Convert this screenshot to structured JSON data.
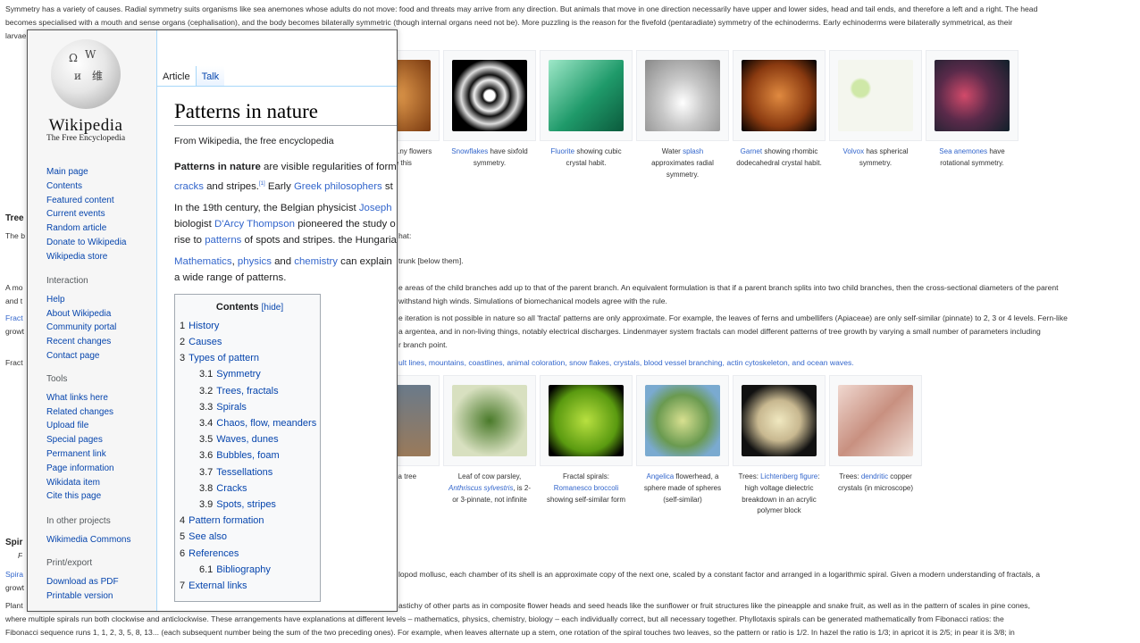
{
  "background": {
    "p1a": "Symmetry has a variety of causes. Radial symmetry suits organisms like sea anemones whose adults do not move: food and threats may arrive from any direction. But animals that move in one direction necessarily have upper and lower sides, head and tail ends, and therefore a left and a right. The head",
    "p1b": "becomes specialised with a mouth and sense organs (cephalisation), and the body becomes bilaterally symmetric (though internal organs need not be). More puzzling is the reason for the fivefold (pentaradiate) symmetry of the echinoderms. Early echinoderms were bilaterally symmetrical, as their",
    "p1c": "larvae still are. ... logical causes.",
    "gallery1": [
      {
        "pre": "",
        "link": "",
        "post": "...metry can ...ny flowers ...ts like this"
      },
      {
        "pre": "",
        "link": "Snowflakes",
        "post": " have sixfold symmetry."
      },
      {
        "pre": "",
        "link": "Fluorite",
        "post": " showing cubic crystal habit."
      },
      {
        "pre": "Water ",
        "link": "splash",
        "post": " approximates radial symmetry."
      },
      {
        "pre": "",
        "link": "Garnet",
        "post": " showing rhombic dodecahedral crystal habit."
      },
      {
        "pre": "",
        "link": "Volvox",
        "post": " has spherical symmetry."
      },
      {
        "pre": "",
        "link": "Sea anemones",
        "post": " have rotational symmetry."
      }
    ],
    "trees_heading": "Tree",
    "trees_sub": "The b",
    "p2a": "hat:",
    "p2b": "trunk [below them].",
    "p3a": "A mo",
    "p3b": "and t",
    "p3c": "e areas of the child branches add up to that of the parent branch. An equivalent formulation is that if a parent branch splits into two child branches, then the cross-sectional diameters of the parent",
    "p3d": "withstand high winds. Simulations of biomechanical models agree with the rule.",
    "p4a": "Fract",
    "p4b": "growt",
    "p4c": "e iteration is not possible in nature so all 'fractal' patterns are only approximate. For example, the leaves of ferns and umbellifers (Apiaceae) are only self-similar (pinnate) to 2, 3 or 4 levels. Fern-like",
    "p4d": "a argentea, and in non-living things, notably electrical discharges. Lindenmayer system fractals can model different patterns of tree growth by varying a small number of parameters including",
    "p4e": "r branch point.",
    "p5a": "Fract",
    "p5b": "ult lines, mountains, coastlines, animal coloration, snow flakes, crystals, blood vessel branching, actin cytoskeleton, and ocean waves.",
    "gallery2": [
      {
        "pre": "",
        "link": "",
        "post": "attern of a tree"
      },
      {
        "pre": "Leaf of cow parsley, ",
        "link": "Anthriscus sylvestris",
        "post": ", is 2- or 3-pinnate, not infinite"
      },
      {
        "pre": "Fractal spirals: ",
        "link": "Romanesco broccoli",
        "post": " showing self-similar form"
      },
      {
        "pre": "",
        "link": "Angelica",
        "post": " flowerhead, a sphere made of spheres (self-similar)"
      },
      {
        "pre": "Trees: ",
        "link": "Lichtenberg figure",
        "post": ": high voltage dielectric breakdown in an acrylic polymer block"
      },
      {
        "pre": "Trees: ",
        "link": "dendritic",
        "post": " copper crystals (in microscope)"
      }
    ],
    "spir_heading": "Spir",
    "spir_sub": "F",
    "p6a": "Spira",
    "p6b": "growt",
    "p6c": "lopod mollusc, each chamber of its shell is an approximate copy of the next one, scaled by a constant factor and arranged in a logarithmic spiral. Given a modern understanding of fractals, a",
    "p7a": "Plant",
    "p7b": "astichy of other parts as in composite flower heads and seed heads like the sunflower or fruit structures like the pineapple and snake fruit, as well as in the pattern of scales in pine cones,",
    "p7c": "where multiple spirals run both clockwise and anticlockwise. These arrangements have explanations at different levels – mathematics, physics, chemistry, biology – each individually correct, but all necessary together. Phyllotaxis spirals can be generated mathematically from Fibonacci ratios: the",
    "p7d": "Fibonacci sequence runs 1, 1, 2, 3, 5, 8, 13... (each subsequent number being the sum of the two preceding ones). For example, when leaves alternate up a stem, one rotation of the spiral touches two leaves, so the pattern or ratio is 1/2. In hazel the ratio is 1/3; in apricot it is 2/5; in pear it is 3/8; in"
  },
  "window": {
    "logo": {
      "wordmark": "Wikipedia",
      "tagline": "The Free Encyclopedia"
    },
    "nav_main": [
      "Main page",
      "Contents",
      "Featured content",
      "Current events",
      "Random article",
      "Donate to Wikipedia",
      "Wikipedia store"
    ],
    "interaction": {
      "heading": "Interaction",
      "items": [
        "Help",
        "About Wikipedia",
        "Community portal",
        "Recent changes",
        "Contact page"
      ]
    },
    "tools": {
      "heading": "Tools",
      "items": [
        "What links here",
        "Related changes",
        "Upload file",
        "Special pages",
        "Permanent link",
        "Page information",
        "Wikidata item",
        "Cite this page"
      ]
    },
    "projects": {
      "heading": "In other projects",
      "items": [
        "Wikimedia Commons"
      ]
    },
    "print": {
      "heading": "Print/export",
      "items": [
        "Download as PDF",
        "Printable version"
      ]
    },
    "tabs": {
      "article": "Article",
      "talk": "Talk"
    },
    "title": "Patterns in nature",
    "from": "From Wikipedia, the free encyclopedia",
    "intro": {
      "l1_bold": "Patterns in nature",
      "l1_rest": " are visible regularities of form",
      "l2_link1": "cracks",
      "l2_mid": " and stripes.",
      "l2_ref": "[1]",
      "l2_after": " Early ",
      "l2_link2": "Greek philosophers",
      "l2_tail": " st",
      "l3_pre": "In the 19th century, the Belgian physicist ",
      "l3_link": "Joseph",
      "l4_pre": "biologist ",
      "l4_link": "D'Arcy Thompson",
      "l4_rest": " pioneered the study o",
      "l5_pre": "rise to ",
      "l5_link": "patterns",
      "l5_rest": " of spots and stripes. the Hungaria",
      "l6_link1": "Mathematics",
      "l6_c": ", ",
      "l6_link2": "physics",
      "l6_and": " and ",
      "l6_link3": "chemistry",
      "l6_rest": " can explain",
      "l7": "a wide range of patterns."
    },
    "toc": {
      "title": "Contents",
      "hide": "hide",
      "rows": [
        {
          "num": "1",
          "label": "History",
          "sub": false
        },
        {
          "num": "2",
          "label": "Causes",
          "sub": false
        },
        {
          "num": "3",
          "label": "Types of pattern",
          "sub": false
        },
        {
          "num": "3.1",
          "label": "Symmetry",
          "sub": true
        },
        {
          "num": "3.2",
          "label": "Trees, fractals",
          "sub": true
        },
        {
          "num": "3.3",
          "label": "Spirals",
          "sub": true
        },
        {
          "num": "3.4",
          "label": "Chaos, flow, meanders",
          "sub": true
        },
        {
          "num": "3.5",
          "label": "Waves, dunes",
          "sub": true
        },
        {
          "num": "3.6",
          "label": "Bubbles, foam",
          "sub": true
        },
        {
          "num": "3.7",
          "label": "Tessellations",
          "sub": true
        },
        {
          "num": "3.8",
          "label": "Cracks",
          "sub": true
        },
        {
          "num": "3.9",
          "label": "Spots, stripes",
          "sub": true
        },
        {
          "num": "4",
          "label": "Pattern formation",
          "sub": false
        },
        {
          "num": "5",
          "label": "See also",
          "sub": false
        },
        {
          "num": "6",
          "label": "References",
          "sub": false
        },
        {
          "num": "6.1",
          "label": "Bibliography",
          "sub": true
        },
        {
          "num": "7",
          "label": "External links",
          "sub": false
        }
      ]
    }
  },
  "colors": {
    "link": "#3366cc",
    "nav_link": "#0645ad",
    "sidebar_bg": "#f6f6f6",
    "tab_border": "#a7d7f9"
  }
}
